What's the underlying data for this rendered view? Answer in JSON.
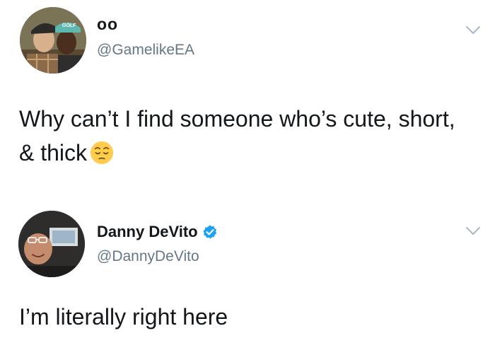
{
  "tweets": [
    {
      "display_name": "oo",
      "handle": "@GamelikeEA",
      "text": "Why can’t I find someone who’s cute, short, & thick",
      "emoji": "pensive-face",
      "avatar_cap_text": "GOLF"
    },
    {
      "display_name": "Danny DeVito",
      "handle": "@DannyDeVito",
      "verified": true,
      "text": "I’m literally right here"
    }
  ],
  "colors": {
    "text": "#14171a",
    "secondary": "#657786",
    "verified_blue": "#1da1f2",
    "chevron": "#aab8c2"
  }
}
